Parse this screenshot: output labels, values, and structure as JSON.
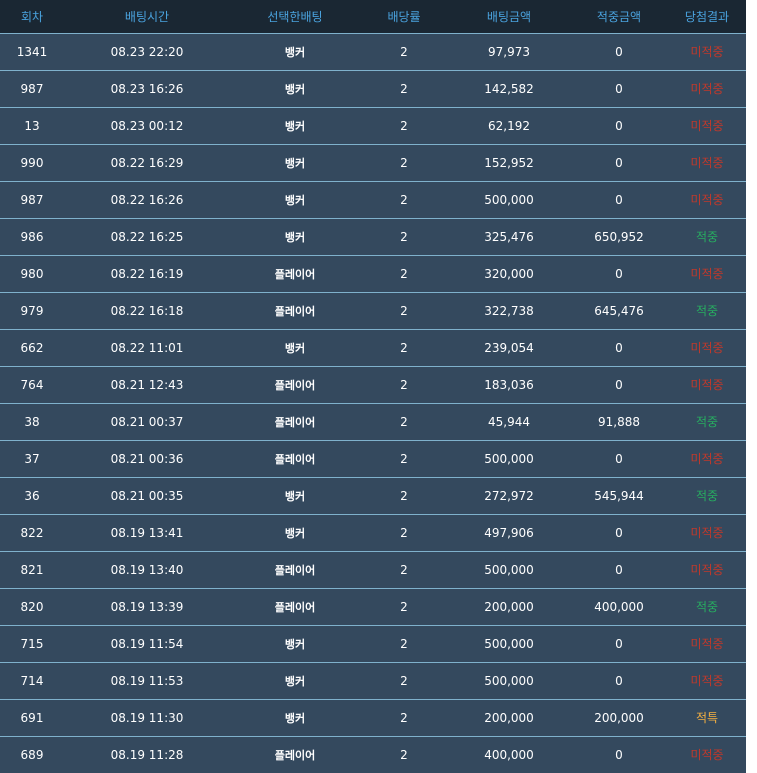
{
  "colors": {
    "header_bg": "#1a2733",
    "header_text": "#4aa3df",
    "row_bg": "#34495e",
    "row_border": "#7fb1cc",
    "lose": "#c0392b",
    "win": "#27ae60",
    "special": "#f5b041"
  },
  "table": {
    "headers": [
      "회차",
      "배팅시간",
      "선택한배팅",
      "배당률",
      "배팅금액",
      "적중금액",
      "당첨결과"
    ],
    "rows": [
      {
        "round": "1341",
        "time": "08.23 22:20",
        "pick": "뱅커",
        "odds": "2",
        "bet": "97,973",
        "win": "0",
        "result": "미적중",
        "status": "lose"
      },
      {
        "round": "987",
        "time": "08.23 16:26",
        "pick": "뱅커",
        "odds": "2",
        "bet": "142,582",
        "win": "0",
        "result": "미적중",
        "status": "lose"
      },
      {
        "round": "13",
        "time": "08.23 00:12",
        "pick": "뱅커",
        "odds": "2",
        "bet": "62,192",
        "win": "0",
        "result": "미적중",
        "status": "lose"
      },
      {
        "round": "990",
        "time": "08.22 16:29",
        "pick": "뱅커",
        "odds": "2",
        "bet": "152,952",
        "win": "0",
        "result": "미적중",
        "status": "lose"
      },
      {
        "round": "987",
        "time": "08.22 16:26",
        "pick": "뱅커",
        "odds": "2",
        "bet": "500,000",
        "win": "0",
        "result": "미적중",
        "status": "lose"
      },
      {
        "round": "986",
        "time": "08.22 16:25",
        "pick": "뱅커",
        "odds": "2",
        "bet": "325,476",
        "win": "650,952",
        "result": "적중",
        "status": "win"
      },
      {
        "round": "980",
        "time": "08.22 16:19",
        "pick": "플레이어",
        "odds": "2",
        "bet": "320,000",
        "win": "0",
        "result": "미적중",
        "status": "lose"
      },
      {
        "round": "979",
        "time": "08.22 16:18",
        "pick": "플레이어",
        "odds": "2",
        "bet": "322,738",
        "win": "645,476",
        "result": "적중",
        "status": "win"
      },
      {
        "round": "662",
        "time": "08.22 11:01",
        "pick": "뱅커",
        "odds": "2",
        "bet": "239,054",
        "win": "0",
        "result": "미적중",
        "status": "lose"
      },
      {
        "round": "764",
        "time": "08.21 12:43",
        "pick": "플레이어",
        "odds": "2",
        "bet": "183,036",
        "win": "0",
        "result": "미적중",
        "status": "lose"
      },
      {
        "round": "38",
        "time": "08.21 00:37",
        "pick": "플레이어",
        "odds": "2",
        "bet": "45,944",
        "win": "91,888",
        "result": "적중",
        "status": "win"
      },
      {
        "round": "37",
        "time": "08.21 00:36",
        "pick": "플레이어",
        "odds": "2",
        "bet": "500,000",
        "win": "0",
        "result": "미적중",
        "status": "lose"
      },
      {
        "round": "36",
        "time": "08.21 00:35",
        "pick": "뱅커",
        "odds": "2",
        "bet": "272,972",
        "win": "545,944",
        "result": "적중",
        "status": "win"
      },
      {
        "round": "822",
        "time": "08.19 13:41",
        "pick": "뱅커",
        "odds": "2",
        "bet": "497,906",
        "win": "0",
        "result": "미적중",
        "status": "lose"
      },
      {
        "round": "821",
        "time": "08.19 13:40",
        "pick": "플레이어",
        "odds": "2",
        "bet": "500,000",
        "win": "0",
        "result": "미적중",
        "status": "lose"
      },
      {
        "round": "820",
        "time": "08.19 13:39",
        "pick": "플레이어",
        "odds": "2",
        "bet": "200,000",
        "win": "400,000",
        "result": "적중",
        "status": "win"
      },
      {
        "round": "715",
        "time": "08.19 11:54",
        "pick": "뱅커",
        "odds": "2",
        "bet": "500,000",
        "win": "0",
        "result": "미적중",
        "status": "lose"
      },
      {
        "round": "714",
        "time": "08.19 11:53",
        "pick": "뱅커",
        "odds": "2",
        "bet": "500,000",
        "win": "0",
        "result": "미적중",
        "status": "lose"
      },
      {
        "round": "691",
        "time": "08.19 11:30",
        "pick": "뱅커",
        "odds": "2",
        "bet": "200,000",
        "win": "200,000",
        "result": "적특",
        "status": "special"
      },
      {
        "round": "689",
        "time": "08.19 11:28",
        "pick": "플레이어",
        "odds": "2",
        "bet": "400,000",
        "win": "0",
        "result": "미적중",
        "status": "lose"
      }
    ]
  }
}
